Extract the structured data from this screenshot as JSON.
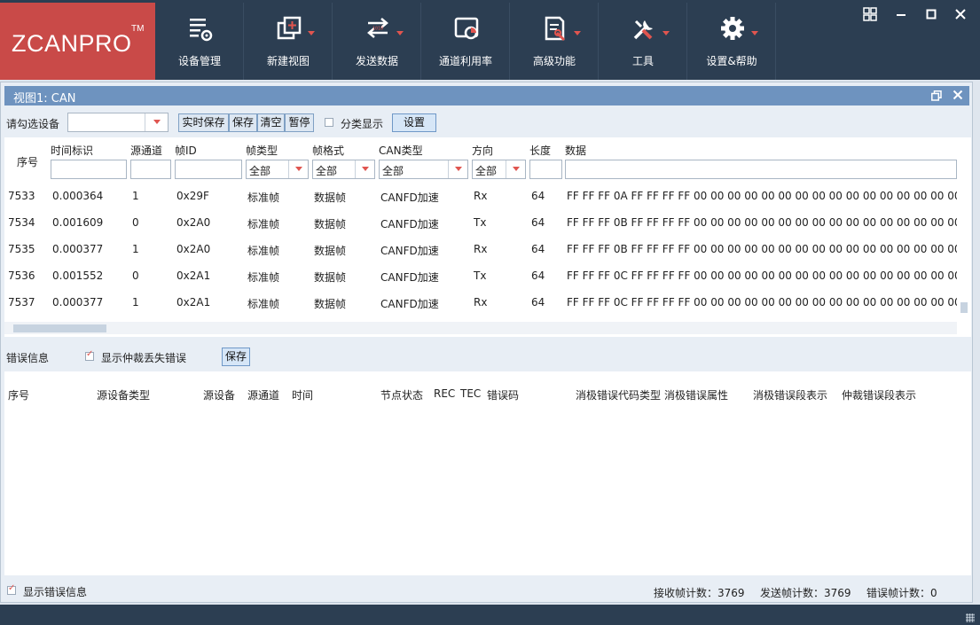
{
  "logo": {
    "text": "ZCANPRO",
    "tm": "TM"
  },
  "toolbar": [
    {
      "label": "设备管理",
      "icon": "device-manage-icon",
      "has_dropdown": false
    },
    {
      "label": "新建视图",
      "icon": "new-view-icon",
      "has_dropdown": true
    },
    {
      "label": "发送数据",
      "icon": "send-data-icon",
      "has_dropdown": true
    },
    {
      "label": "通道利用率",
      "icon": "channel-usage-icon",
      "has_dropdown": false
    },
    {
      "label": "高级功能",
      "icon": "advanced-icon",
      "has_dropdown": true
    },
    {
      "label": "工具",
      "icon": "tools-icon",
      "has_dropdown": true
    },
    {
      "label": "设置&帮助",
      "icon": "settings-gear-icon",
      "has_dropdown": true
    }
  ],
  "view": {
    "title": "视图1: CAN",
    "device_label": "请勾选设备",
    "device_value": "",
    "buttons": {
      "realtime_save": "实时保存",
      "save": "保存",
      "clear": "清空",
      "pause": "暂停",
      "settings": "设置"
    },
    "classify_label": "分类显示",
    "classify_checked": false
  },
  "table": {
    "headers": {
      "seq": "序号",
      "timestamp": "时间标识",
      "channel": "源通道",
      "frame_id": "帧ID",
      "frame_type": "帧类型",
      "frame_format": "帧格式",
      "can_type": "CAN类型",
      "direction": "方向",
      "length": "长度",
      "data": "数据"
    },
    "filters": {
      "frame_type": "全部",
      "frame_format": "全部",
      "can_type": "全部",
      "direction": "全部"
    },
    "rows": [
      {
        "seq": "7533",
        "timestamp": "0.000364",
        "channel": "1",
        "frame_id": "0x29F",
        "frame_type": "标准帧",
        "frame_format": "数据帧",
        "can_type": "CANFD加速",
        "direction": "Rx",
        "length": "64",
        "data": "FF FF FF 0A FF FF FF FF 00 00 00 00 00 00 00 00 00 00 00 00 00 00 00 00 00 00 00 00 0"
      },
      {
        "seq": "7534",
        "timestamp": "0.001609",
        "channel": "0",
        "frame_id": "0x2A0",
        "frame_type": "标准帧",
        "frame_format": "数据帧",
        "can_type": "CANFD加速",
        "direction": "Tx",
        "length": "64",
        "data": "FF FF FF 0B FF FF FF FF 00 00 00 00 00 00 00 00 00 00 00 00 00 00 00 00 00 00 00 00 0"
      },
      {
        "seq": "7535",
        "timestamp": "0.000377",
        "channel": "1",
        "frame_id": "0x2A0",
        "frame_type": "标准帧",
        "frame_format": "数据帧",
        "can_type": "CANFD加速",
        "direction": "Rx",
        "length": "64",
        "data": "FF FF FF 0B FF FF FF FF 00 00 00 00 00 00 00 00 00 00 00 00 00 00 00 00 00 00 00 00 0"
      },
      {
        "seq": "7536",
        "timestamp": "0.001552",
        "channel": "0",
        "frame_id": "0x2A1",
        "frame_type": "标准帧",
        "frame_format": "数据帧",
        "can_type": "CANFD加速",
        "direction": "Tx",
        "length": "64",
        "data": "FF FF FF 0C FF FF FF FF 00 00 00 00 00 00 00 00 00 00 00 00 00 00 00 00 00 00 00 00 0"
      },
      {
        "seq": "7537",
        "timestamp": "0.000377",
        "channel": "1",
        "frame_id": "0x2A1",
        "frame_type": "标准帧",
        "frame_format": "数据帧",
        "can_type": "CANFD加速",
        "direction": "Rx",
        "length": "64",
        "data": "FF FF FF 0C FF FF FF FF 00 00 00 00 00 00 00 00 00 00 00 00 00 00 00 00 00 00 00 00 0"
      }
    ]
  },
  "errors": {
    "label": "错误信息",
    "show_arb_lost_label": "显示仲裁丢失错误",
    "show_arb_lost_checked": true,
    "save_label": "保存",
    "headers": [
      "序号",
      "源设备类型",
      "源设备",
      "源通道",
      "时间",
      "节点状态",
      "REC",
      "TEC",
      "错误码",
      "消极错误代码类型",
      "消极错误属性",
      "消极错误段表示",
      "仲裁错误段表示"
    ]
  },
  "status": {
    "show_errors_label": "显示错误信息",
    "show_errors_checked": true,
    "recv_count": "接收帧计数：3769",
    "send_count": "发送帧计数：3769",
    "err_count": "错误帧计数：0"
  },
  "colors": {
    "toolbar_bg": "#2c3e52",
    "logo_bg": "#c94a48",
    "view_title_bg": "#6e93bf",
    "accent": "#e0554f"
  }
}
